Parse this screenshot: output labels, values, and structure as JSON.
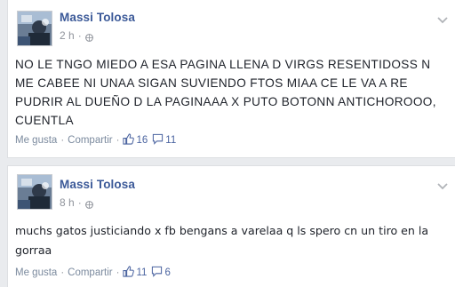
{
  "posts": [
    {
      "author": "Massi Tolosa",
      "time": "2 h",
      "privacy_icon": "globe-icon",
      "body": "NO LE TNGO MIEDO A ESA PAGINA LLENA D VIRGS RESENTIDOSS N\nME CABEE NI UNAA SIGAN SUVIENDO FTOS MIAA CE LE VA A RE\nPUDRIR AL DUEÑO D LA PAGINAAA X PUTO BOTONN ANTICHOROOO,\nCUENTLA",
      "like_label": "Me gusta",
      "share_label": "Compartir",
      "like_count": "16",
      "comment_count": "11"
    },
    {
      "author": "Massi Tolosa",
      "time": "8 h",
      "privacy_icon": "globe-icon",
      "body": "muchs gatos justiciando x fb bengans a varelaa q ls spero cn un tiro en la\ngorraa",
      "like_label": "Me gusta",
      "share_label": "Compartir",
      "like_count": "11",
      "comment_count": "6"
    }
  ],
  "colors": {
    "link_blue": "#3b5998",
    "meta_gray": "#90949c",
    "background": "#e9ebee"
  }
}
